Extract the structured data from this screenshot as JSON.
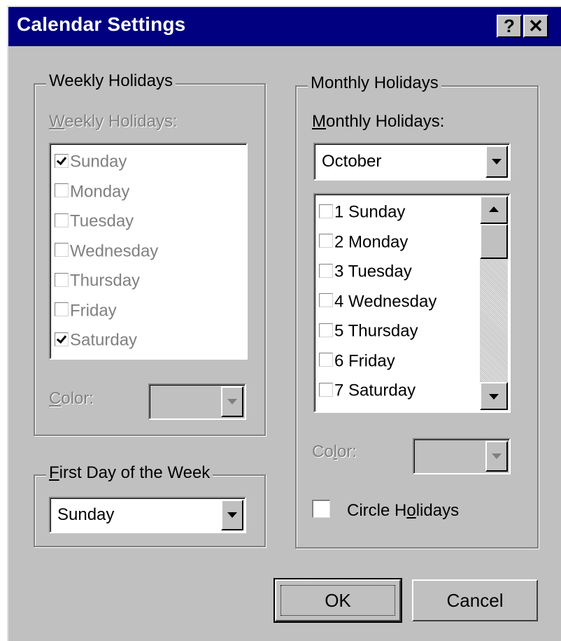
{
  "window": {
    "title": "Calendar Settings",
    "help_glyph": "?",
    "close_glyph": "✕"
  },
  "weekly": {
    "group_title": "Weekly Holidays",
    "list_label_first": "W",
    "list_label_rest": "eekly Holidays:",
    "days": [
      {
        "label": "Sunday",
        "checked": true
      },
      {
        "label": "Monday",
        "checked": false
      },
      {
        "label": "Tuesday",
        "checked": false
      },
      {
        "label": "Wednesday",
        "checked": false
      },
      {
        "label": "Thursday",
        "checked": false
      },
      {
        "label": "Friday",
        "checked": false
      },
      {
        "label": "Saturday",
        "checked": true
      }
    ],
    "color_label_first": "C",
    "color_label_rest": "olor:"
  },
  "first_day": {
    "group_title_first": "F",
    "group_title_rest": "irst Day of the Week",
    "value": "Sunday"
  },
  "monthly": {
    "group_title": "Monthly Holidays",
    "list_label_first": "M",
    "list_label_rest": "onthly Holidays:",
    "month_value": "October",
    "dates": [
      {
        "label": "1 Sunday",
        "checked": false
      },
      {
        "label": "2 Monday",
        "checked": false
      },
      {
        "label": "3 Tuesday",
        "checked": false
      },
      {
        "label": "4 Wednesday",
        "checked": false
      },
      {
        "label": "5 Thursday",
        "checked": false
      },
      {
        "label": "6 Friday",
        "checked": false
      },
      {
        "label": "7 Saturday",
        "checked": false
      }
    ],
    "color_label_first": "Co",
    "color_label_u": "l",
    "color_label_rest": "or:",
    "circle_holidays": {
      "label_a": "Circle H",
      "label_u": "o",
      "label_b": "lidays",
      "checked": false
    }
  },
  "buttons": {
    "ok": "OK",
    "cancel": "Cancel"
  },
  "colors": {
    "titlebar": "#000080",
    "face": "#c0c0c0",
    "disabled_text": "#808080"
  }
}
